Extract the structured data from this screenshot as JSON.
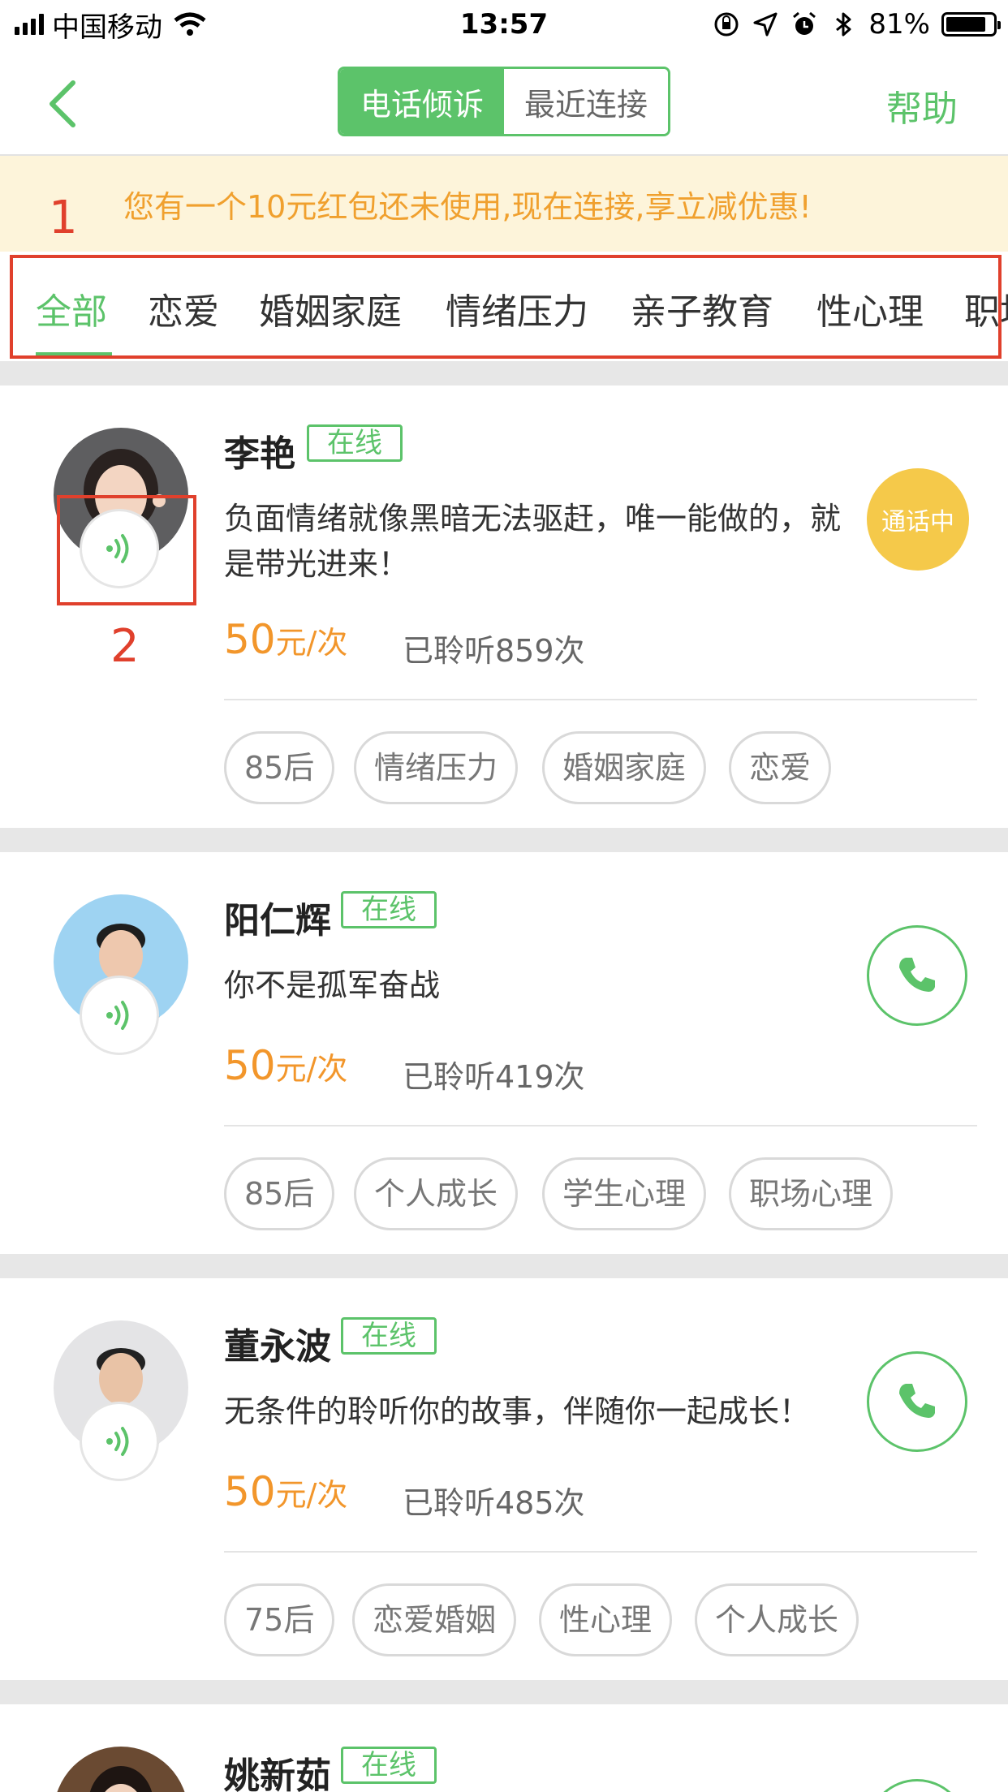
{
  "status_bar": {
    "carrier": "中国移动",
    "time": "13:57",
    "battery": "81%",
    "battery_level": 0.81
  },
  "nav": {
    "segments": [
      "电话倾诉",
      "最近连接"
    ],
    "active_segment": 0,
    "help": "帮助"
  },
  "promo": {
    "text": "您有一个10元红包还未使用,现在连接,享立减优惠!"
  },
  "annotations": {
    "label_1": "1",
    "label_2": "2"
  },
  "tabs": {
    "items": [
      "全部",
      "恋爱",
      "婚姻家庭",
      "情绪压力",
      "亲子教育",
      "性心理",
      "职场心理"
    ],
    "active": 0
  },
  "counselors": [
    {
      "name": "李艳",
      "status": "在线",
      "motto": "负面情绪就像黑暗无法驱赶，唯一能做的，就是带光进来！",
      "price": "50",
      "price_unit": "元/次",
      "listened": "已聆听859次",
      "tags": [
        "85后",
        "情绪压力",
        "婚姻家庭",
        "恋爱"
      ],
      "call_state": "通话中"
    },
    {
      "name": "阳仁辉",
      "status": "在线",
      "motto": "你不是孤军奋战",
      "price": "50",
      "price_unit": "元/次",
      "listened": "已聆听419次",
      "tags": [
        "85后",
        "个人成长",
        "学生心理",
        "职场心理"
      ]
    },
    {
      "name": "董永波",
      "status": "在线",
      "motto": "无条件的聆听你的故事，伴随你一起成长！",
      "price": "50",
      "price_unit": "元/次",
      "listened": "已聆听485次",
      "tags": [
        "75后",
        "恋爱婚姻",
        "性心理",
        "个人成长"
      ]
    },
    {
      "name": "姚新茹",
      "status": "在线"
    }
  ],
  "colors": {
    "brand_green": "#5cc36a",
    "price_orange": "#f2962b",
    "busy_yellow": "#f5c94a",
    "promo_bg": "#fdf4da",
    "annotation_red": "#e0402c"
  },
  "icons": {
    "back": "chevron-left-icon",
    "voice": "voice-wave-icon",
    "call": "phone-icon"
  }
}
